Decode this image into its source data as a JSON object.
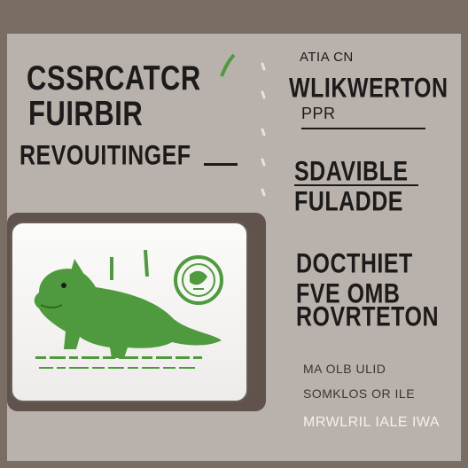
{
  "left_block": {
    "line1": "CSSRCATCR",
    "line2": "FUIRBIR",
    "line3": "REVOUITINGEF"
  },
  "right_block": {
    "small_top": "ATIA     CN",
    "line1": "WLIKWERTON",
    "line2": "PPR",
    "line3": "SDAVIBLE",
    "line4": "FULADDE",
    "line5": "DOCTHIET",
    "line6": "FVE OMB",
    "line7": "ROVRTETON",
    "small1": "MA  OLB  ULID",
    "small2": "SOMKLOS  OR  ILE",
    "small3": "MRWLRIL  IALE  IWA"
  },
  "colors": {
    "background": "#7a6e64",
    "poster": "#b9b2ac",
    "ink": "#1c1a1a",
    "green": "#4f9a3e"
  }
}
